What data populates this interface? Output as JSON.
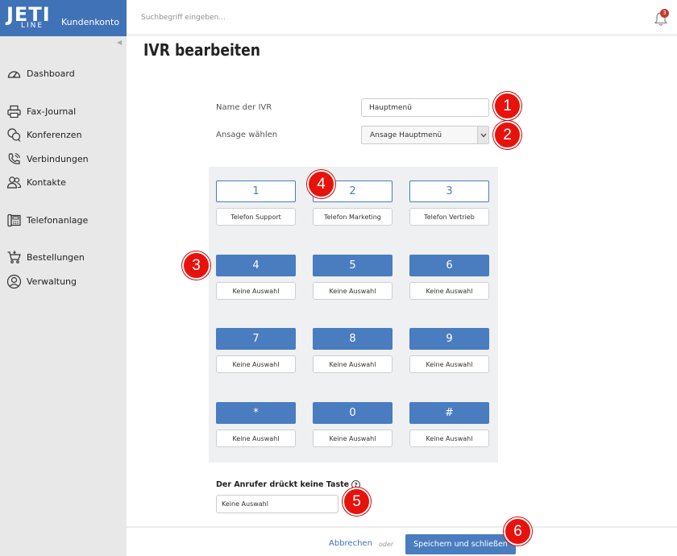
{
  "brand": {
    "logo_main": "JETI",
    "logo_sub": "LINE",
    "label": "Kundenkonto",
    "color": "#3f72b7"
  },
  "topbar": {
    "search_placeholder": "Suchbegriff eingeben...",
    "notification_count": "3"
  },
  "sidebar": {
    "items": [
      {
        "label": "Dashboard",
        "icon": "speedometer-icon"
      },
      {
        "label": "Fax-Journal",
        "icon": "printer-icon"
      },
      {
        "label": "Konferenzen",
        "icon": "conference-icon"
      },
      {
        "label": "Verbindungen",
        "icon": "phone-call-icon"
      },
      {
        "label": "Kontakte",
        "icon": "contacts-icon"
      },
      {
        "label": "Telefonanlage",
        "icon": "phone-system-icon"
      },
      {
        "label": "Bestellungen",
        "icon": "cart-icon"
      },
      {
        "label": "Verwaltung",
        "icon": "user-admin-icon"
      }
    ]
  },
  "page": {
    "title": "IVR bearbeiten"
  },
  "form": {
    "name_label": "Name der IVR",
    "name_value": "Hauptmenü",
    "announcement_label": "Ansage wählen",
    "announcement_value": "Ansage Hauptmenü"
  },
  "keypad": {
    "keys": [
      {
        "key": "1",
        "target": "Telefon Support",
        "active": true
      },
      {
        "key": "2",
        "target": "Telefon Marketing",
        "active": true
      },
      {
        "key": "3",
        "target": "Telefon Vertrieb",
        "active": true
      },
      {
        "key": "4",
        "target": "Keine Auswahl",
        "active": false
      },
      {
        "key": "5",
        "target": "Keine Auswahl",
        "active": false
      },
      {
        "key": "6",
        "target": "Keine Auswahl",
        "active": false
      },
      {
        "key": "7",
        "target": "Keine Auswahl",
        "active": false
      },
      {
        "key": "8",
        "target": "Keine Auswahl",
        "active": false
      },
      {
        "key": "9",
        "target": "Keine Auswahl",
        "active": false
      },
      {
        "key": "*",
        "target": "Keine Auswahl",
        "active": false
      },
      {
        "key": "0",
        "target": "Keine Auswahl",
        "active": false
      },
      {
        "key": "#",
        "target": "Keine Auswahl",
        "active": false
      }
    ]
  },
  "no_input": {
    "label": "Der Anrufer drückt keine Taste",
    "value": "Keine Auswahl"
  },
  "footer": {
    "cancel_label": "Abbrechen",
    "or_label": "oder",
    "save_label": "Speichern und schließen"
  },
  "callouts": [
    "1",
    "2",
    "3",
    "4",
    "5",
    "6"
  ],
  "colors": {
    "accent": "#4a7cc0",
    "callout": "#e8120c",
    "sidebar_bg": "#e8e8e8"
  }
}
